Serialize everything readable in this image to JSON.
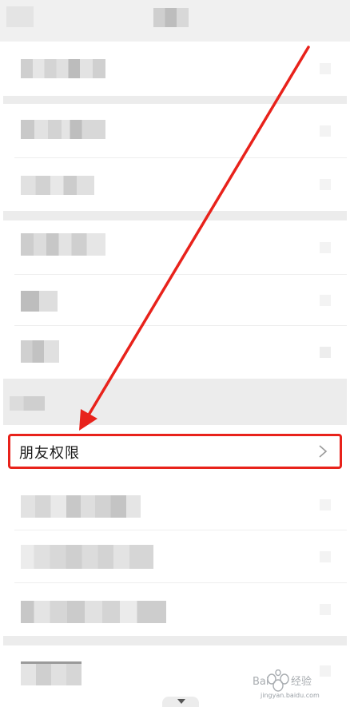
{
  "highlighted_item": {
    "label": "朋友权限"
  },
  "watermark": {
    "brand": "Baidu 经验",
    "url": "jingyan.baidu.com"
  },
  "colors": {
    "highlight": "#e8221b",
    "background": "#ececec",
    "row": "#ffffff"
  },
  "icons": [
    "chevron-right-icon",
    "chevron-down-icon",
    "red-pointer-arrow"
  ]
}
